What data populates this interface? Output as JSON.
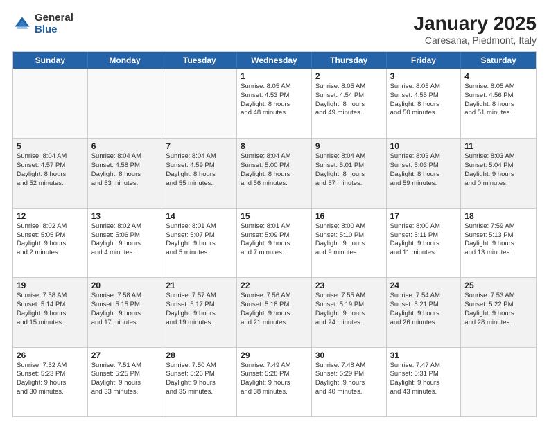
{
  "header": {
    "logo_general": "General",
    "logo_blue": "Blue",
    "month_title": "January 2025",
    "location": "Caresana, Piedmont, Italy"
  },
  "weekdays": [
    "Sunday",
    "Monday",
    "Tuesday",
    "Wednesday",
    "Thursday",
    "Friday",
    "Saturday"
  ],
  "weeks": [
    [
      {
        "day": "",
        "info": ""
      },
      {
        "day": "",
        "info": ""
      },
      {
        "day": "",
        "info": ""
      },
      {
        "day": "1",
        "info": "Sunrise: 8:05 AM\nSunset: 4:53 PM\nDaylight: 8 hours\nand 48 minutes."
      },
      {
        "day": "2",
        "info": "Sunrise: 8:05 AM\nSunset: 4:54 PM\nDaylight: 8 hours\nand 49 minutes."
      },
      {
        "day": "3",
        "info": "Sunrise: 8:05 AM\nSunset: 4:55 PM\nDaylight: 8 hours\nand 50 minutes."
      },
      {
        "day": "4",
        "info": "Sunrise: 8:05 AM\nSunset: 4:56 PM\nDaylight: 8 hours\nand 51 minutes."
      }
    ],
    [
      {
        "day": "5",
        "info": "Sunrise: 8:04 AM\nSunset: 4:57 PM\nDaylight: 8 hours\nand 52 minutes."
      },
      {
        "day": "6",
        "info": "Sunrise: 8:04 AM\nSunset: 4:58 PM\nDaylight: 8 hours\nand 53 minutes."
      },
      {
        "day": "7",
        "info": "Sunrise: 8:04 AM\nSunset: 4:59 PM\nDaylight: 8 hours\nand 55 minutes."
      },
      {
        "day": "8",
        "info": "Sunrise: 8:04 AM\nSunset: 5:00 PM\nDaylight: 8 hours\nand 56 minutes."
      },
      {
        "day": "9",
        "info": "Sunrise: 8:04 AM\nSunset: 5:01 PM\nDaylight: 8 hours\nand 57 minutes."
      },
      {
        "day": "10",
        "info": "Sunrise: 8:03 AM\nSunset: 5:03 PM\nDaylight: 8 hours\nand 59 minutes."
      },
      {
        "day": "11",
        "info": "Sunrise: 8:03 AM\nSunset: 5:04 PM\nDaylight: 9 hours\nand 0 minutes."
      }
    ],
    [
      {
        "day": "12",
        "info": "Sunrise: 8:02 AM\nSunset: 5:05 PM\nDaylight: 9 hours\nand 2 minutes."
      },
      {
        "day": "13",
        "info": "Sunrise: 8:02 AM\nSunset: 5:06 PM\nDaylight: 9 hours\nand 4 minutes."
      },
      {
        "day": "14",
        "info": "Sunrise: 8:01 AM\nSunset: 5:07 PM\nDaylight: 9 hours\nand 5 minutes."
      },
      {
        "day": "15",
        "info": "Sunrise: 8:01 AM\nSunset: 5:09 PM\nDaylight: 9 hours\nand 7 minutes."
      },
      {
        "day": "16",
        "info": "Sunrise: 8:00 AM\nSunset: 5:10 PM\nDaylight: 9 hours\nand 9 minutes."
      },
      {
        "day": "17",
        "info": "Sunrise: 8:00 AM\nSunset: 5:11 PM\nDaylight: 9 hours\nand 11 minutes."
      },
      {
        "day": "18",
        "info": "Sunrise: 7:59 AM\nSunset: 5:13 PM\nDaylight: 9 hours\nand 13 minutes."
      }
    ],
    [
      {
        "day": "19",
        "info": "Sunrise: 7:58 AM\nSunset: 5:14 PM\nDaylight: 9 hours\nand 15 minutes."
      },
      {
        "day": "20",
        "info": "Sunrise: 7:58 AM\nSunset: 5:15 PM\nDaylight: 9 hours\nand 17 minutes."
      },
      {
        "day": "21",
        "info": "Sunrise: 7:57 AM\nSunset: 5:17 PM\nDaylight: 9 hours\nand 19 minutes."
      },
      {
        "day": "22",
        "info": "Sunrise: 7:56 AM\nSunset: 5:18 PM\nDaylight: 9 hours\nand 21 minutes."
      },
      {
        "day": "23",
        "info": "Sunrise: 7:55 AM\nSunset: 5:19 PM\nDaylight: 9 hours\nand 24 minutes."
      },
      {
        "day": "24",
        "info": "Sunrise: 7:54 AM\nSunset: 5:21 PM\nDaylight: 9 hours\nand 26 minutes."
      },
      {
        "day": "25",
        "info": "Sunrise: 7:53 AM\nSunset: 5:22 PM\nDaylight: 9 hours\nand 28 minutes."
      }
    ],
    [
      {
        "day": "26",
        "info": "Sunrise: 7:52 AM\nSunset: 5:23 PM\nDaylight: 9 hours\nand 30 minutes."
      },
      {
        "day": "27",
        "info": "Sunrise: 7:51 AM\nSunset: 5:25 PM\nDaylight: 9 hours\nand 33 minutes."
      },
      {
        "day": "28",
        "info": "Sunrise: 7:50 AM\nSunset: 5:26 PM\nDaylight: 9 hours\nand 35 minutes."
      },
      {
        "day": "29",
        "info": "Sunrise: 7:49 AM\nSunset: 5:28 PM\nDaylight: 9 hours\nand 38 minutes."
      },
      {
        "day": "30",
        "info": "Sunrise: 7:48 AM\nSunset: 5:29 PM\nDaylight: 9 hours\nand 40 minutes."
      },
      {
        "day": "31",
        "info": "Sunrise: 7:47 AM\nSunset: 5:31 PM\nDaylight: 9 hours\nand 43 minutes."
      },
      {
        "day": "",
        "info": ""
      }
    ]
  ]
}
